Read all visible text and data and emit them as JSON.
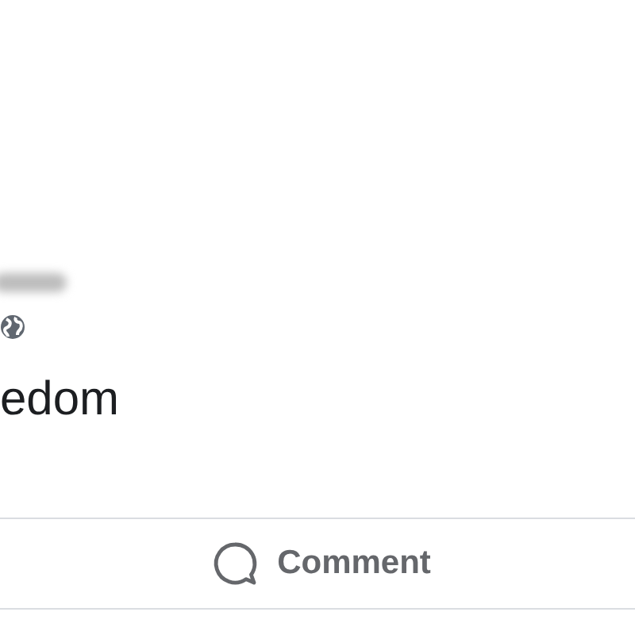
{
  "post": {
    "body_text": "edom"
  },
  "actions": [
    {
      "kind": "comment",
      "label": "Comment"
    }
  ]
}
